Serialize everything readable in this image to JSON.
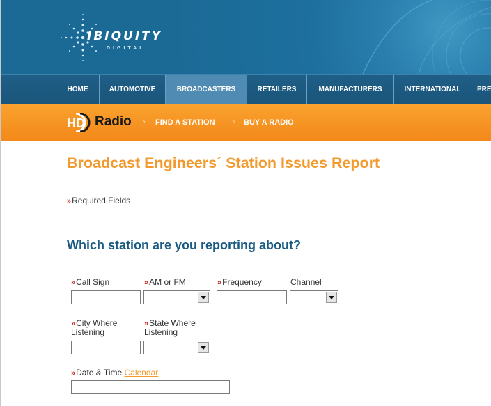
{
  "brand": {
    "name": "IBIQUITY",
    "sub": "DIGITAL"
  },
  "nav": {
    "items": [
      {
        "label": "HOME"
      },
      {
        "label": "AUTOMOTIVE"
      },
      {
        "label": "BROADCASTERS"
      },
      {
        "label": "RETAILERS"
      },
      {
        "label": "MANUFACTURERS"
      },
      {
        "label": "INTERNATIONAL"
      },
      {
        "label": "PRE"
      }
    ],
    "active": "BROADCASTERS"
  },
  "hdbar": {
    "logo_hd": "HD",
    "logo_radio": "Radio",
    "links": [
      {
        "label": "FIND A STATION"
      },
      {
        "label": "BUY A RADIO"
      }
    ],
    "arrow": "›"
  },
  "page": {
    "title": "Broadcast Engineers´ Station Issues Report",
    "required_note": "Required Fields",
    "required_marker": "»",
    "section_title": "Which station are you reporting about?"
  },
  "form": {
    "call_sign": {
      "label": "Call Sign",
      "value": ""
    },
    "am_fm": {
      "label": "AM or FM",
      "value": ""
    },
    "frequency": {
      "label": "Frequency",
      "value": ""
    },
    "channel": {
      "label": "Channel",
      "value": ""
    },
    "city": {
      "label_line1": "City Where",
      "label_line2": "Listening",
      "value": ""
    },
    "state": {
      "label_line1": "State Where",
      "label_line2": "Listening",
      "value": ""
    },
    "date_time": {
      "label": "Date & Time",
      "link": "Calendar",
      "value": ""
    }
  }
}
